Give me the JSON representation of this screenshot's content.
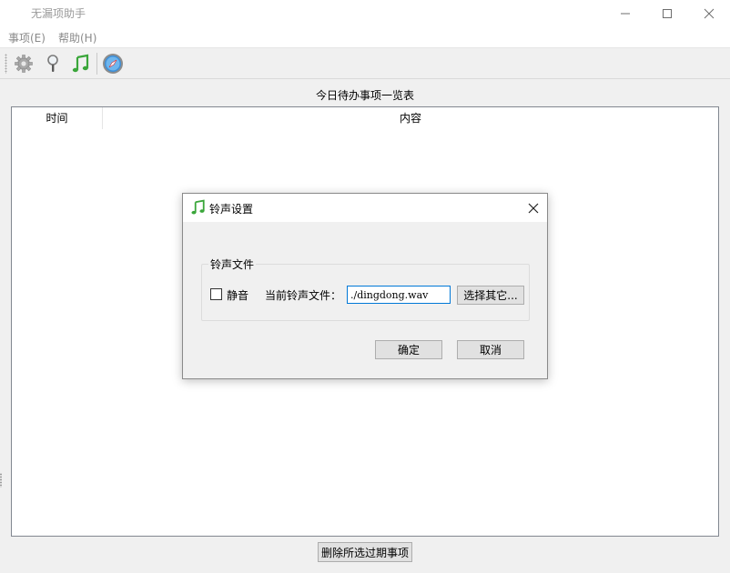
{
  "window": {
    "title": "无漏项助手",
    "controls": {
      "minimize": "minimize-icon",
      "maximize": "maximize-icon",
      "close": "close-icon"
    }
  },
  "menubar": {
    "items": [
      {
        "label": "事项(E)"
      },
      {
        "label": "帮助(H)"
      }
    ]
  },
  "toolbar": {
    "icons": [
      "gear-icon",
      "magnifier-icon",
      "music-note-icon",
      "compass-icon"
    ]
  },
  "main": {
    "list_title": "今日待办事项一览表",
    "columns": [
      "时间",
      "内容"
    ],
    "rows": [],
    "delete_button": "删除所选过期事项"
  },
  "dialog": {
    "title": "铃声设置",
    "group_title": "铃声文件",
    "mute_label": "静音",
    "mute_checked": false,
    "current_file_label": "当前铃声文件：",
    "current_file_value": "./dingdong.wav",
    "browse_button": "选择其它...",
    "ok_button": "确定",
    "cancel_button": "取消"
  },
  "colors": {
    "accent": "#0078d7",
    "note_green": "#3aa63a"
  }
}
